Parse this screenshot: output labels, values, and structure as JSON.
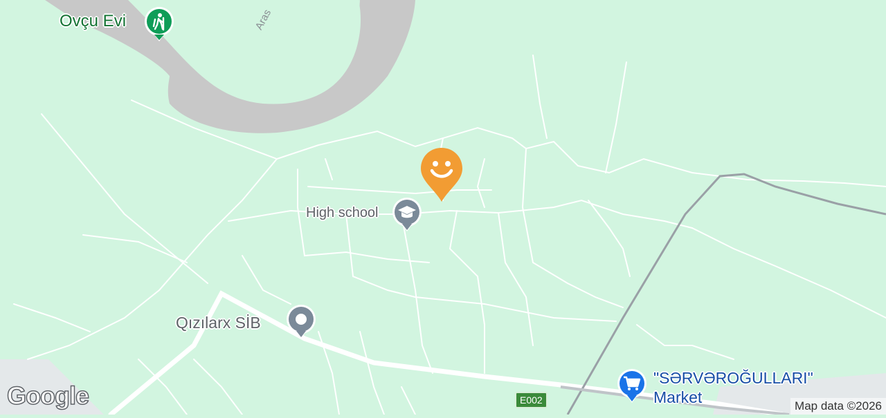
{
  "map": {
    "river_label": "Aras",
    "places": [
      {
        "name": "Ovçu Evi",
        "icon": "hiking-icon",
        "color": "#0f9d58"
      },
      {
        "name": "High school",
        "icon": "graduation-cap-icon",
        "color": "#7b8a99"
      },
      {
        "name": "Qızılarx SİB",
        "icon": "place-dot-icon",
        "color": "#7b8a99"
      },
      {
        "name": "\"SƏRVƏROĞULLARI\"",
        "name2": "Market",
        "icon": "shopping-cart-icon",
        "color": "#1a73e8"
      }
    ],
    "marker": {
      "icon": "smiley-icon",
      "color": "#f29c33"
    },
    "road_shield": "E002",
    "attribution": "Map data ©2026",
    "logo": "Google"
  }
}
